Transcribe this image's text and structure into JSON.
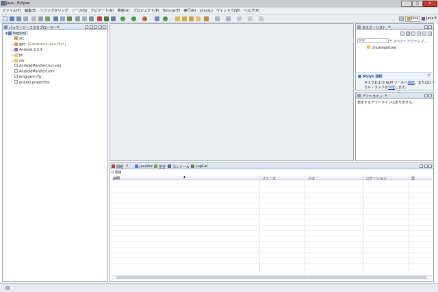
{
  "window": {
    "title": "Java - Eclipse"
  },
  "menu": [
    "ファイル(F)",
    "編集(E)",
    "リファクタリング",
    "ソース(S)",
    "ナビゲート(N)",
    "検索(A)",
    "プロジェクト(P)",
    "Tomcat(T)",
    "実行(R)",
    "Limy(L)",
    "ウィンドウ(W)",
    "ヘルプ(H)"
  ],
  "perspectives": {
    "java": "Java",
    "javaee": "Java E"
  },
  "package_explorer": {
    "tab": "パッケージ・エクスプローラー",
    "project": "hogproj",
    "items": [
      {
        "label": "src",
        "suffix": ""
      },
      {
        "label": "gen",
        "suffix": "[Generated Java Files]"
      },
      {
        "label": "Android 2.3.3",
        "suffix": ""
      },
      {
        "label": "jni",
        "suffix": ""
      },
      {
        "label": "res",
        "suffix": ""
      },
      {
        "label": "AndroidManifest.out.xml",
        "suffix": ""
      },
      {
        "label": "AndroidManifest.xml",
        "suffix": ""
      },
      {
        "label": "proguard.cfg",
        "suffix": ""
      },
      {
        "label": "project.properties",
        "suffix": ""
      }
    ]
  },
  "task_list": {
    "tab": "タスク・リスト",
    "search_placeholder": "検索",
    "filter_all": "すべて",
    "filter_active": "アクティブ...",
    "category": "Uncategorized",
    "mylyn_title": "Mylyn 接続",
    "mylyn_text1": "タスクおよび ALM ツールへ",
    "mylyn_link1": "接続",
    "mylyn_text2": "、またはロー",
    "mylyn_text3": "カル・タスクを",
    "mylyn_link2": "作成",
    "mylyn_text4": "します。"
  },
  "outline": {
    "tab": "アウトライン",
    "message": "表示するアウトラインはありません。"
  },
  "problems": {
    "tabs": [
      "問題",
      "Javadoc",
      "宣言",
      "コンソール",
      "LogCat"
    ],
    "count": "0 項目",
    "columns": [
      "説明",
      "リソース",
      "パス",
      "ロケーション",
      "型"
    ]
  },
  "colors": {
    "accent": "#3b5ea8",
    "link": "#1f4bb3",
    "folder": "#e7c35a",
    "error": "#c43b36"
  }
}
